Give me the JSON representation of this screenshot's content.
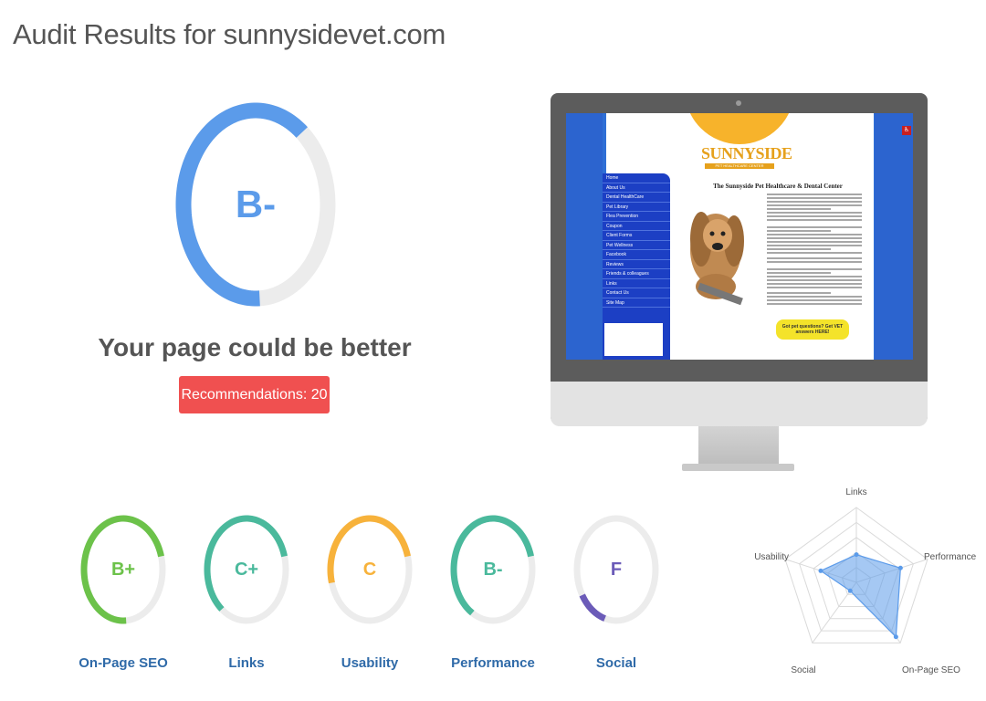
{
  "page": {
    "title": "Audit Results for sunnysidevet.com"
  },
  "overall": {
    "grade": "B-",
    "headline": "Your page could be better",
    "recommendations_label": "Recommendations: 20",
    "score_fraction": 0.62,
    "color": "#5b9bea"
  },
  "preview": {
    "site_logo": "SUNNYSIDE",
    "site_logo_sub": "PET HEALTHCARE CENTER",
    "site_heading": "The Sunnyside Pet Healthcare & Dental Center",
    "nav_items": [
      "Home",
      "About Us",
      "Dental HealthCare",
      "Pet Library",
      "Flea Prevention",
      "Coupon",
      "Client Forms",
      "Pet Wellness",
      "Facebook",
      "Reviews",
      "Friends & colleagues",
      "Links",
      "Contact Us",
      "Site Map"
    ],
    "badge_text": "Got pet questions? Get VET answers HERE!",
    "access_icon": "wheelchair-icon"
  },
  "categories": [
    {
      "grade": "B+",
      "label": "On-Page SEO",
      "color": "#6cc24a",
      "fraction": 0.72
    },
    {
      "grade": "C+",
      "label": "Links",
      "color": "#4ab99c",
      "fraction": 0.6
    },
    {
      "grade": "C",
      "label": "Usability",
      "color": "#f7b23b",
      "fraction": 0.5
    },
    {
      "grade": "B-",
      "label": "Performance",
      "color": "#4ab99c",
      "fraction": 0.62
    },
    {
      "grade": "F",
      "label": "Social",
      "color": "#6b5bb8",
      "fraction": 0.12
    }
  ],
  "radar": {
    "axes": [
      "Links",
      "Performance",
      "On-Page SEO",
      "Social",
      "Usability"
    ],
    "values": [
      0.37,
      0.62,
      0.9,
      0.14,
      0.5
    ],
    "fill_color": "#5b9bea"
  }
}
